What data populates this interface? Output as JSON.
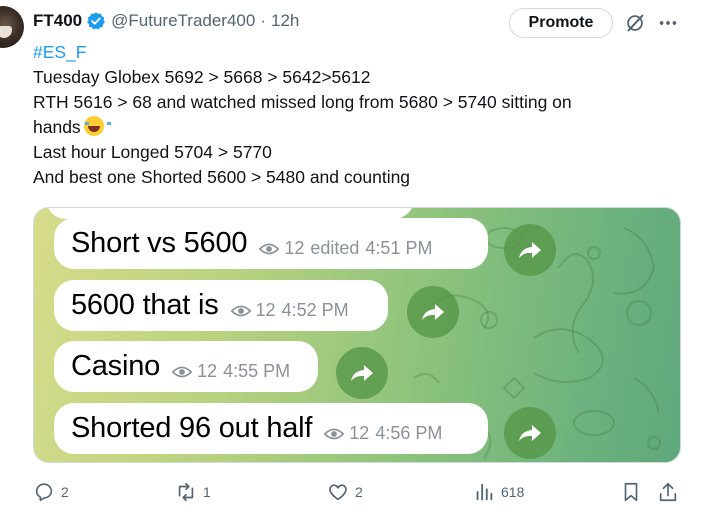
{
  "tweet": {
    "author_name": "FT400",
    "handle": "@FutureTrader400",
    "separator": "·",
    "time": "12h",
    "promote_label": "Promote",
    "hashtag": "#ES_F",
    "lines": [
      "Tuesday Globex 5692 > 5668 > 5642>5612",
      "RTH 5616 > 68 and watched missed long from 5680 > 5740 sitting on",
      "hands",
      "Last hour Longed 5704  > 5770",
      "And best one Shorted 5600 > 5480 and counting"
    ]
  },
  "media": {
    "messages": [
      {
        "text": "Short vs 5600",
        "views": "12",
        "edited": "edited",
        "time": "4:51 PM"
      },
      {
        "text": "5600 that is",
        "views": "12",
        "time": "4:52 PM"
      },
      {
        "text": "Casino",
        "views": "12",
        "time": "4:55 PM"
      },
      {
        "text": "Shorted 96 out half",
        "views": "12",
        "time": "4:56 PM"
      }
    ]
  },
  "actions": {
    "replies": "2",
    "reposts": "1",
    "likes": "2",
    "views": "618"
  },
  "colors": {
    "accent": "#1d9bf0",
    "muted": "#536471",
    "forward_button": "#5c9a4a"
  },
  "icons": [
    "verified-badge-icon",
    "grok-icon",
    "more-icon",
    "reply-icon",
    "repost-icon",
    "like-icon",
    "views-icon",
    "bookmark-icon",
    "share-icon",
    "eye-icon",
    "forward-icon",
    "laughing-emoji"
  ]
}
